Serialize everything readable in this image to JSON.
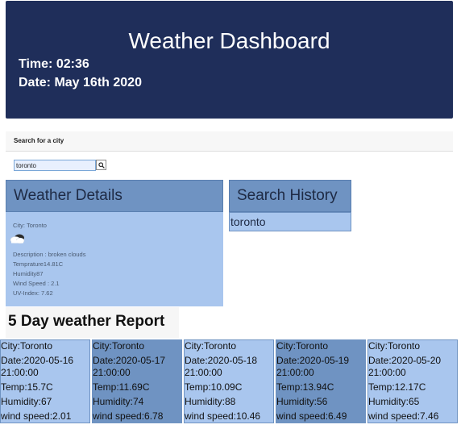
{
  "header": {
    "title": "Weather Dashboard",
    "time": "Time: 02:36",
    "date": "Date: May 16th 2020"
  },
  "search": {
    "card_title": "Search for a city",
    "input_value": "toronto",
    "button_icon": "search-icon"
  },
  "details": {
    "heading": "Weather Details",
    "city": "City: Toronto",
    "icon": "broken-clouds-icon",
    "description": "Description : broken clouds",
    "temperature": "Temprature14.81C",
    "humidity": "Humidity87",
    "wind_speed": "Wind Speed : 2.1",
    "uv_index": "UV-Index: 7.62"
  },
  "history": {
    "heading": "Search History",
    "items": [
      "toronto"
    ]
  },
  "forecast": {
    "heading": "5 Day weather Report",
    "days": [
      {
        "city": "City:Toronto",
        "date": "Date:2020-05-16",
        "time": "21:00:00",
        "temp": "Temp:15.7C",
        "humidity": "Humidity:67",
        "wind": "wind speed:2.01"
      },
      {
        "city": "City:Toronto",
        "date": "Date:2020-05-17",
        "time": "21:00:00",
        "temp": "Temp:11.69C",
        "humidity": "Humidity:74",
        "wind": "wind speed:6.78"
      },
      {
        "city": "City:Toronto",
        "date": "Date:2020-05-18",
        "time": "21:00:00",
        "temp": "Temp:10.09C",
        "humidity": "Humidity:88",
        "wind": "wind speed:10.46"
      },
      {
        "city": "City:Toronto",
        "date": "Date:2020-05-19",
        "time": "21:00:00",
        "temp": "Temp:13.94C",
        "humidity": "Humidity:56",
        "wind": "wind speed:6.49"
      },
      {
        "city": "City:Toronto",
        "date": "Date:2020-05-20",
        "time": "21:00:00",
        "temp": "Temp:12.17C",
        "humidity": "Humidity:65",
        "wind": "wind speed:7.46"
      }
    ]
  },
  "colors": {
    "header_bg": "#1f2e5a",
    "panel_head": "#6f93c2",
    "panel_body": "#a9c6ee"
  }
}
